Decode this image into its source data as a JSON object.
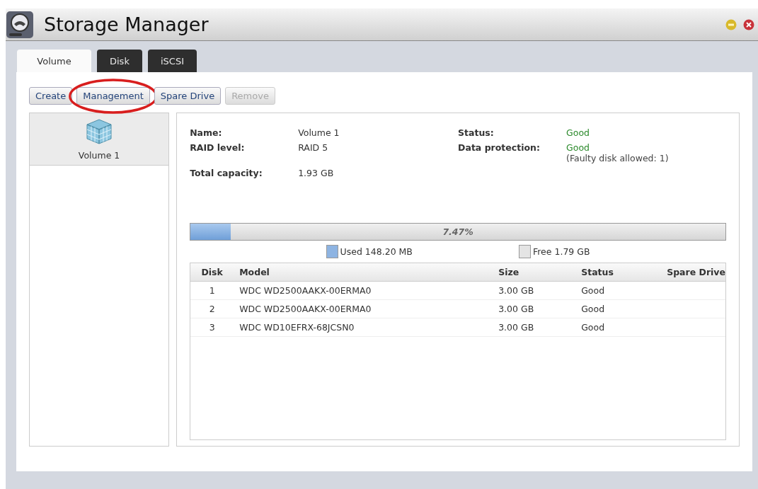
{
  "window": {
    "title": "Storage Manager"
  },
  "tabs": [
    {
      "label": "Volume",
      "selected": true
    },
    {
      "label": "Disk",
      "selected": false
    },
    {
      "label": "iSCSI",
      "selected": false
    }
  ],
  "toolbar": [
    {
      "label": "Create",
      "disabled": false,
      "highlighted": false
    },
    {
      "label": "Management",
      "disabled": false,
      "highlighted": true
    },
    {
      "label": "Spare Drive",
      "disabled": false,
      "highlighted": false
    },
    {
      "label": "Remove",
      "disabled": true,
      "highlighted": false
    }
  ],
  "volumes": [
    {
      "label": "Volume 1",
      "selected": true
    }
  ],
  "details": [
    {
      "label": "Name:",
      "value": "Volume 1",
      "kind": "plain"
    },
    {
      "label": "Status:",
      "value": "Good",
      "kind": "good"
    },
    {
      "label": "RAID level:",
      "value": "RAID 5",
      "kind": "plain"
    },
    {
      "label": "Data protection:",
      "value": "Good",
      "note": "(Faulty disk allowed: 1)",
      "kind": "good"
    },
    {
      "label": "Total capacity:",
      "value": "1.93 GB",
      "kind": "plain"
    }
  ],
  "usage": {
    "level": 0.0747,
    "reading": "7.47%",
    "used": "Used 148.20 MB",
    "free": "Free 1.79 GB"
  },
  "table": {
    "columns": [
      "Disk",
      "Model",
      "Size",
      "Status",
      "Spare Drive"
    ],
    "rows": [
      [
        "1",
        "WDC WD2500AAKX-00ERMA0",
        "3.00 GB",
        "Good"
      ],
      [
        "2",
        "WDC WD2500AAKX-00ERMA0",
        "3.00 GB",
        "Good"
      ],
      [
        "3",
        "WDC WD10EFRX-68JCSN0",
        "3.00 GB",
        "Good"
      ]
    ]
  }
}
